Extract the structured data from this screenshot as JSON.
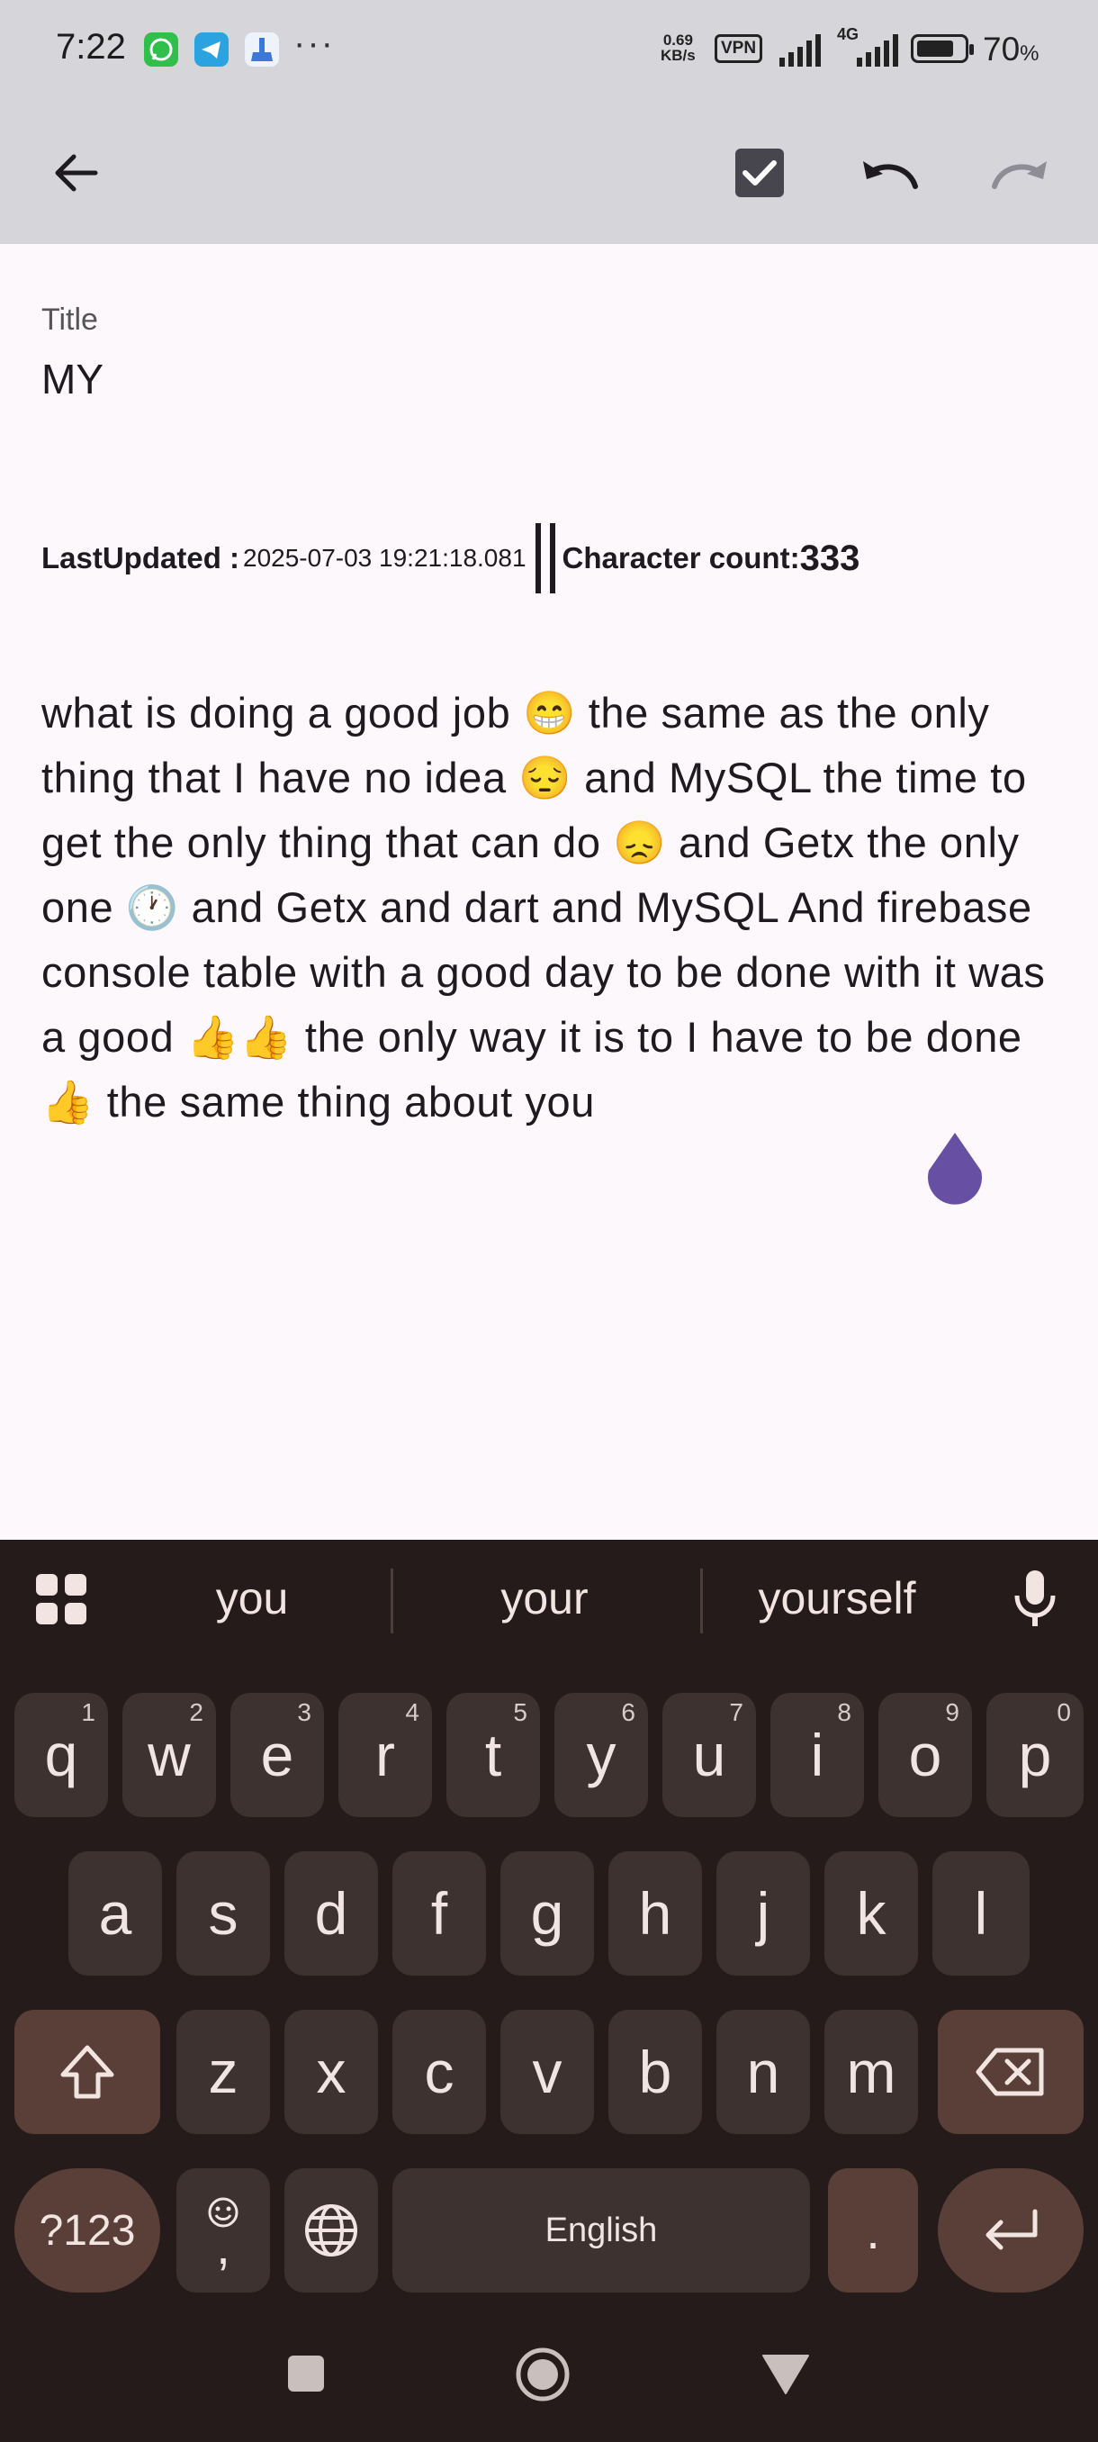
{
  "status_bar": {
    "time": "7:22",
    "net_speed_value": "0.69",
    "net_speed_unit": "KB/s",
    "vpn": "VPN",
    "battery": "70",
    "battery_unit": "%",
    "network_type": "4G",
    "more": "···"
  },
  "app_bar": {
    "back_icon": "arrow-left-icon",
    "save_icon": "checkbox-checked-icon",
    "undo_icon": "undo-icon",
    "redo_icon": "redo-icon"
  },
  "note": {
    "title_label": "Title",
    "title_value": "MY",
    "last_updated_label": "LastUpdated :",
    "last_updated_value": "2025-07-03 19:21:18.081",
    "char_count_label": "Character count:",
    "char_count_value": "333",
    "body": "what is doing a good job 😁 the same as the only thing that I have no idea 😔 and MySQL the time to get the only thing that can do 😞 and Getx the only one 🕐 and Getx and dart and MySQL And firebase console table with a good day to be done with it was a good 👍👍 the only way it is to I have to be done 👍 the same thing about you"
  },
  "keyboard": {
    "suggestions": [
      "you",
      "your",
      "yourself"
    ],
    "row1": [
      {
        "k": "q",
        "h": "1"
      },
      {
        "k": "w",
        "h": "2"
      },
      {
        "k": "e",
        "h": "3"
      },
      {
        "k": "r",
        "h": "4"
      },
      {
        "k": "t",
        "h": "5"
      },
      {
        "k": "y",
        "h": "6"
      },
      {
        "k": "u",
        "h": "7"
      },
      {
        "k": "i",
        "h": "8"
      },
      {
        "k": "o",
        "h": "9"
      },
      {
        "k": "p",
        "h": "0"
      }
    ],
    "row2": [
      "a",
      "s",
      "d",
      "f",
      "g",
      "h",
      "j",
      "k",
      "l"
    ],
    "row3": [
      "z",
      "x",
      "c",
      "v",
      "b",
      "n",
      "m"
    ],
    "symbols_label": "?123",
    "comma_label": ",",
    "space_label": "English",
    "period_label": "."
  },
  "colors": {
    "appbar_bg": "#d6d5da",
    "page_bg": "#fcf8fb",
    "keyboard_bg": "#251b1a",
    "key_bg": "#3d3230",
    "func_key_bg": "#5a3f39",
    "cursor_handle": "#6750a4"
  }
}
